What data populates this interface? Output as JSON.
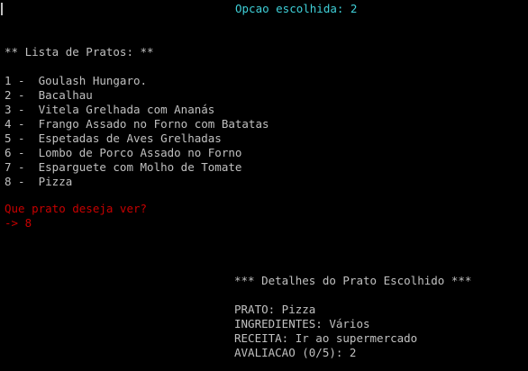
{
  "header": {
    "choice_text": "Opcao escolhida: 2"
  },
  "list": {
    "title": "** Lista de Pratos: **",
    "items": [
      "1 -  Goulash Hungaro.",
      "2 -  Bacalhau",
      "3 -  Vitela Grelhada com Ananás",
      "4 -  Frango Assado no Forno com Batatas",
      "5 -  Espetadas de Aves Grelhadas",
      "6 -  Lombo de Porco Assado no Forno",
      "7 -  Esparguete com Molho de Tomate",
      "8 -  Pizza"
    ]
  },
  "prompt": {
    "question": "Que prato deseja ver?",
    "input": "-> 8"
  },
  "details": {
    "title": "*** Detalhes do Prato Escolhido ***",
    "prato": "PRATO: Pizza",
    "ingredientes": "INGREDIENTES: Vários",
    "receita": "RECEITA: Ir ao supermercado",
    "avaliacao": "AVALIACAO (0/5): 2"
  },
  "colors": {
    "background": "#000000",
    "text": "#c0c0c0",
    "accent_cyan": "#3fd0d8",
    "prompt_red": "#c80000"
  }
}
